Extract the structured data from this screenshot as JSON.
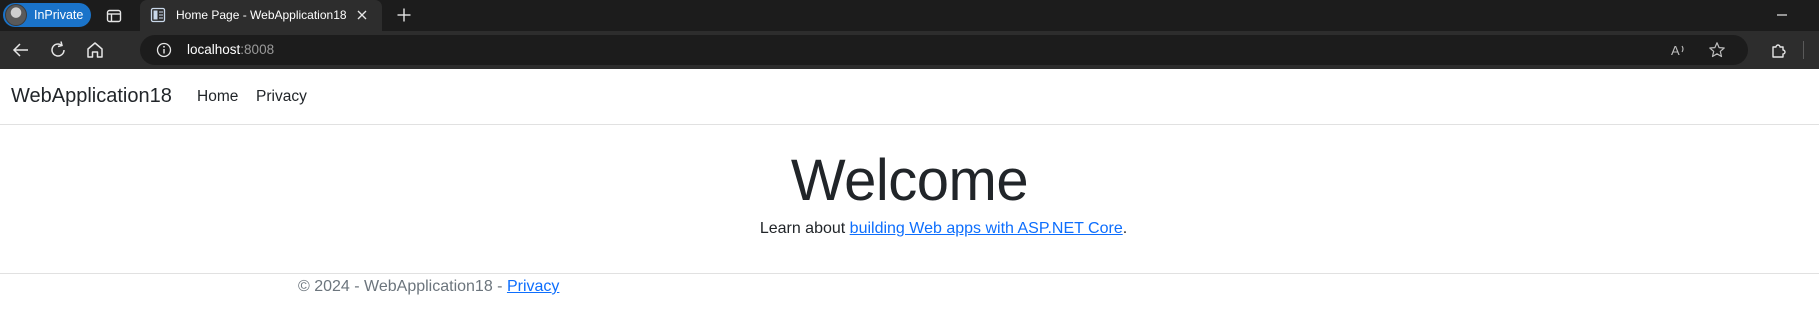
{
  "browser": {
    "profile_label": "InPrivate",
    "tab_title": "Home Page - WebApplication18",
    "url_host": "localhost",
    "url_port": ":8008",
    "accent": "#1a73c9"
  },
  "site": {
    "brand": "WebApplication18",
    "nav": [
      {
        "label": "Home"
      },
      {
        "label": "Privacy"
      }
    ],
    "heading": "Welcome",
    "learn_prefix": "Learn about ",
    "learn_link": "building Web apps with ASP.NET Core",
    "learn_suffix": ".",
    "footer_text": "© 2024 - WebApplication18 - ",
    "footer_link": "Privacy",
    "link_color": "#0d6efd"
  },
  "icons": {
    "profile": "avatar-icon",
    "tab_actions": "tab-actions-icon",
    "favicon": "page-favicon-icon",
    "close": "close-icon",
    "new_tab": "plus-icon",
    "minimize": "minimize-icon",
    "back": "back-arrow-icon",
    "refresh": "refresh-icon",
    "home": "home-icon",
    "info": "info-icon",
    "read_aloud": "read-aloud-icon",
    "favorites": "star-icon",
    "extensions": "puzzle-icon"
  }
}
